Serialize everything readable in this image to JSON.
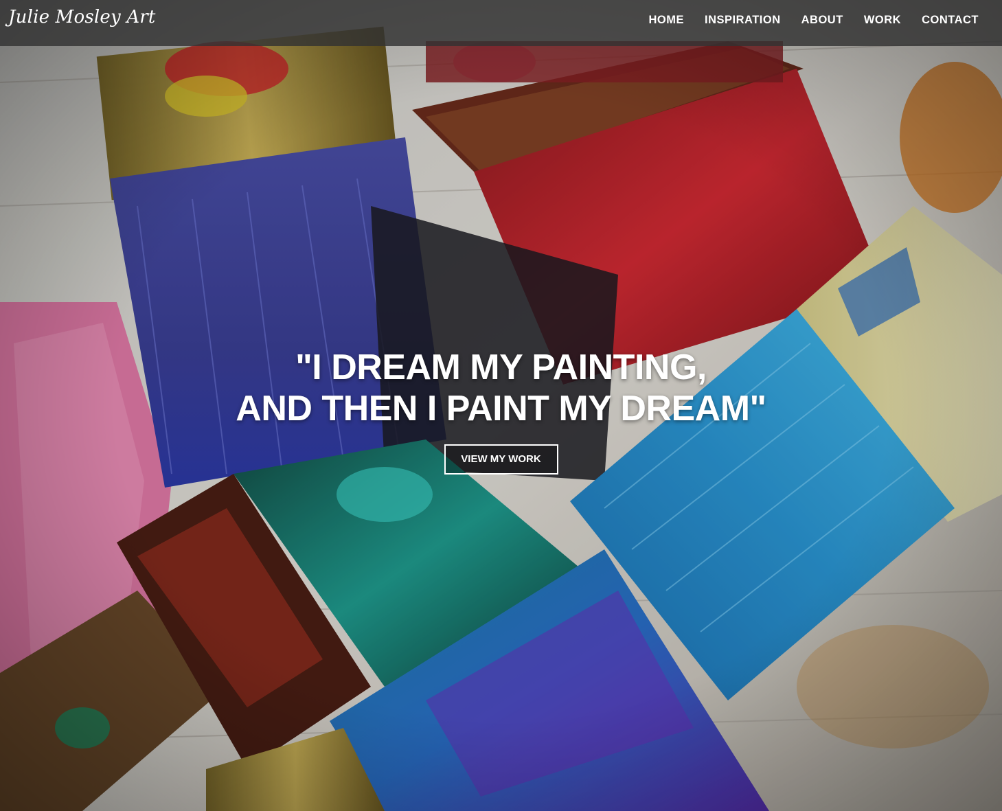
{
  "header": {
    "brand": "Julie Mosley Art",
    "nav": [
      {
        "label": "HOME"
      },
      {
        "label": "INSPIRATION"
      },
      {
        "label": "ABOUT"
      },
      {
        "label": "WORK"
      },
      {
        "label": "CONTACT"
      }
    ]
  },
  "hero": {
    "quote_line1": "\"I DREAM MY PAINTING,",
    "quote_line2": "AND THEN I PAINT MY DREAM\"",
    "cta_label": "VIEW MY WORK",
    "background_image": "paint-brushes-photo"
  },
  "colors": {
    "navbar_bg": "#323232",
    "text": "#ffffff",
    "brush_blue": "#3f4fb8",
    "brush_red": "#c41f2a",
    "brush_cyan": "#2aa3d6",
    "brush_teal": "#1f9c8f",
    "sponge_pink": "#e27aa8",
    "ferrule_gold": "#b7a046"
  }
}
